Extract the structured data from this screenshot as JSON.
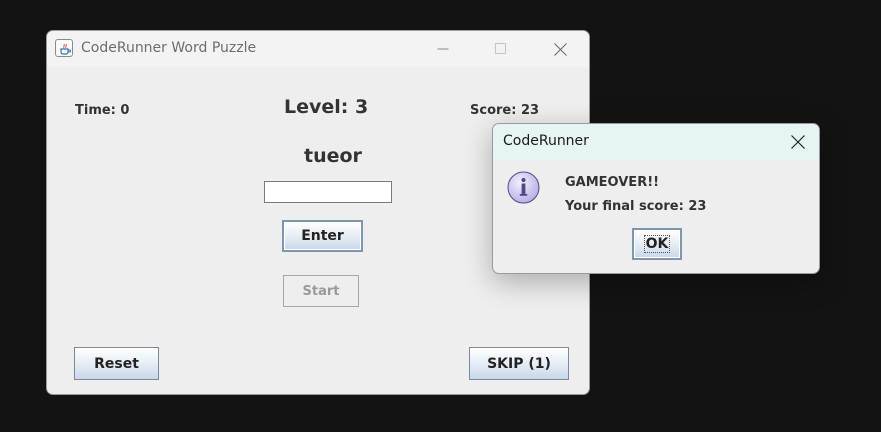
{
  "main_window": {
    "title": "CodeRunner Word Puzzle",
    "time_label": "Time: 0",
    "level_label": "Level: 3",
    "score_label": "Score: 23",
    "scrambled_word": "tueor",
    "answer_input": {
      "value": "",
      "placeholder": ""
    },
    "enter_button": "Enter",
    "start_button": "Start",
    "reset_button": "Reset",
    "skip_button": "SKIP (1)"
  },
  "dialog": {
    "title": "CodeRunner",
    "message_line1": "GAMEOVER!!",
    "message_line2": "Your final score: 23",
    "ok_button": "OK",
    "icon": "info-icon"
  },
  "colors": {
    "desktop_background": "#131313",
    "window_background": "#eeeeee",
    "dialog_titlebar": "#e6f5f4",
    "button_gradient_bottom": "#c9d8e8",
    "info_icon_fill": "#cdc6ee"
  }
}
